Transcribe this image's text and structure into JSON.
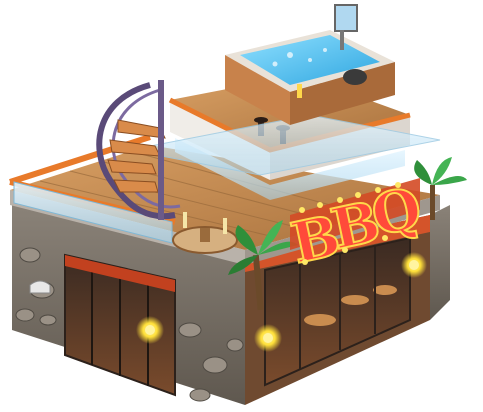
{
  "sign": {
    "letters": [
      "B",
      "B",
      "Q"
    ]
  },
  "colors": {
    "sign_neon": "#e8352b",
    "sign_bulb": "#ffd84a",
    "roof_trim": "#e87a2a",
    "deck_wood": "#c98c4f",
    "stone": "#7d756b",
    "water": "#5fc3f0",
    "glass": "#bfe3f5",
    "palm": "#2f8f3a"
  },
  "icons": [
    "hot-tub-icon",
    "palm-tree-icon",
    "lantern-icon",
    "spiral-stair-icon",
    "umbrella-icon"
  ]
}
